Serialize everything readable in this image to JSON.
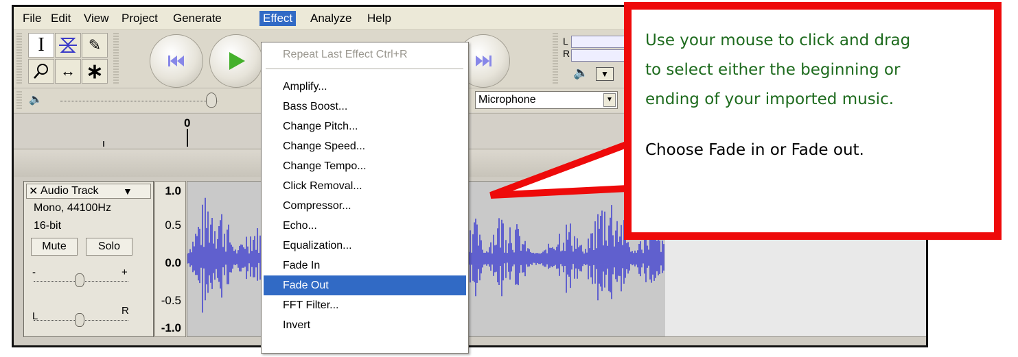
{
  "menubar": {
    "items": [
      "File",
      "Edit",
      "View",
      "Project",
      "Generate",
      "Effect",
      "Analyze",
      "Help"
    ],
    "active": "Effect"
  },
  "toolbar": {
    "tools": [
      "selection-tool",
      "envelope-tool",
      "draw-tool",
      "zoom-tool",
      "time-shift-tool",
      "multi-tool"
    ],
    "meter_labels": {
      "left": "L",
      "right": "R"
    },
    "input_device": "Microphone"
  },
  "ruler": {
    "start_label": "0"
  },
  "track": {
    "name": "Audio Track",
    "format": "Mono, 44100Hz",
    "bit_depth": "16-bit",
    "mute_label": "Mute",
    "solo_label": "Solo",
    "pan_left": "L",
    "pan_right": "R",
    "gain_minus": "-",
    "gain_plus": "+",
    "scale": [
      "1.0",
      "0.5",
      "0.0",
      "-0.5",
      "-1.0"
    ]
  },
  "effect_menu": {
    "repeat_last": "Repeat Last Effect  Ctrl+R",
    "items": [
      "Amplify...",
      "Bass Boost...",
      "Change Pitch...",
      "Change Speed...",
      "Change Tempo...",
      "Click Removal...",
      "Compressor...",
      "Echo...",
      "Equalization...",
      "Fade In",
      "Fade Out",
      "FFT Filter...",
      "Invert"
    ],
    "highlighted": "Fade Out"
  },
  "callout": {
    "line1": "Use  your mouse to click and drag",
    "line2": "to select either the beginning or",
    "line3": "ending of your imported music.",
    "line4": "Choose Fade in or Fade out.",
    "text_color_green": "#1e6b1e",
    "border_color": "#ee0a0a"
  },
  "colors": {
    "menu_highlight": "#316ac5",
    "waveform": "#3434d0",
    "transport_play": "#44b02b",
    "transport_skip": "#8787e8"
  }
}
